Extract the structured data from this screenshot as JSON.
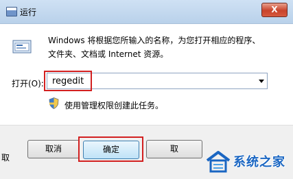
{
  "window": {
    "title": "运行",
    "close_glyph": "X"
  },
  "description": {
    "line1": "Windows 将根据您所输入的名称，为您打开相应的程序、",
    "line2": "文件夹、文档或 Internet 资源。"
  },
  "open_field": {
    "label": "打开(O):",
    "value": "regedit"
  },
  "admin_note": "使用管理权限创建此任务。",
  "buttons": {
    "left_label": "取消",
    "ok_label": "确定",
    "right_label": "取"
  },
  "edge_text": "取",
  "watermark": {
    "brand": "系统之家"
  },
  "colors": {
    "highlight_red": "#d21f1f",
    "title_bar": "#cfe1f4",
    "brand_blue": "#1a66c2"
  },
  "icons": [
    "run-app-icon",
    "shield-icon",
    "dropdown-arrow-icon",
    "close-icon",
    "watermark-logo-icon"
  ]
}
